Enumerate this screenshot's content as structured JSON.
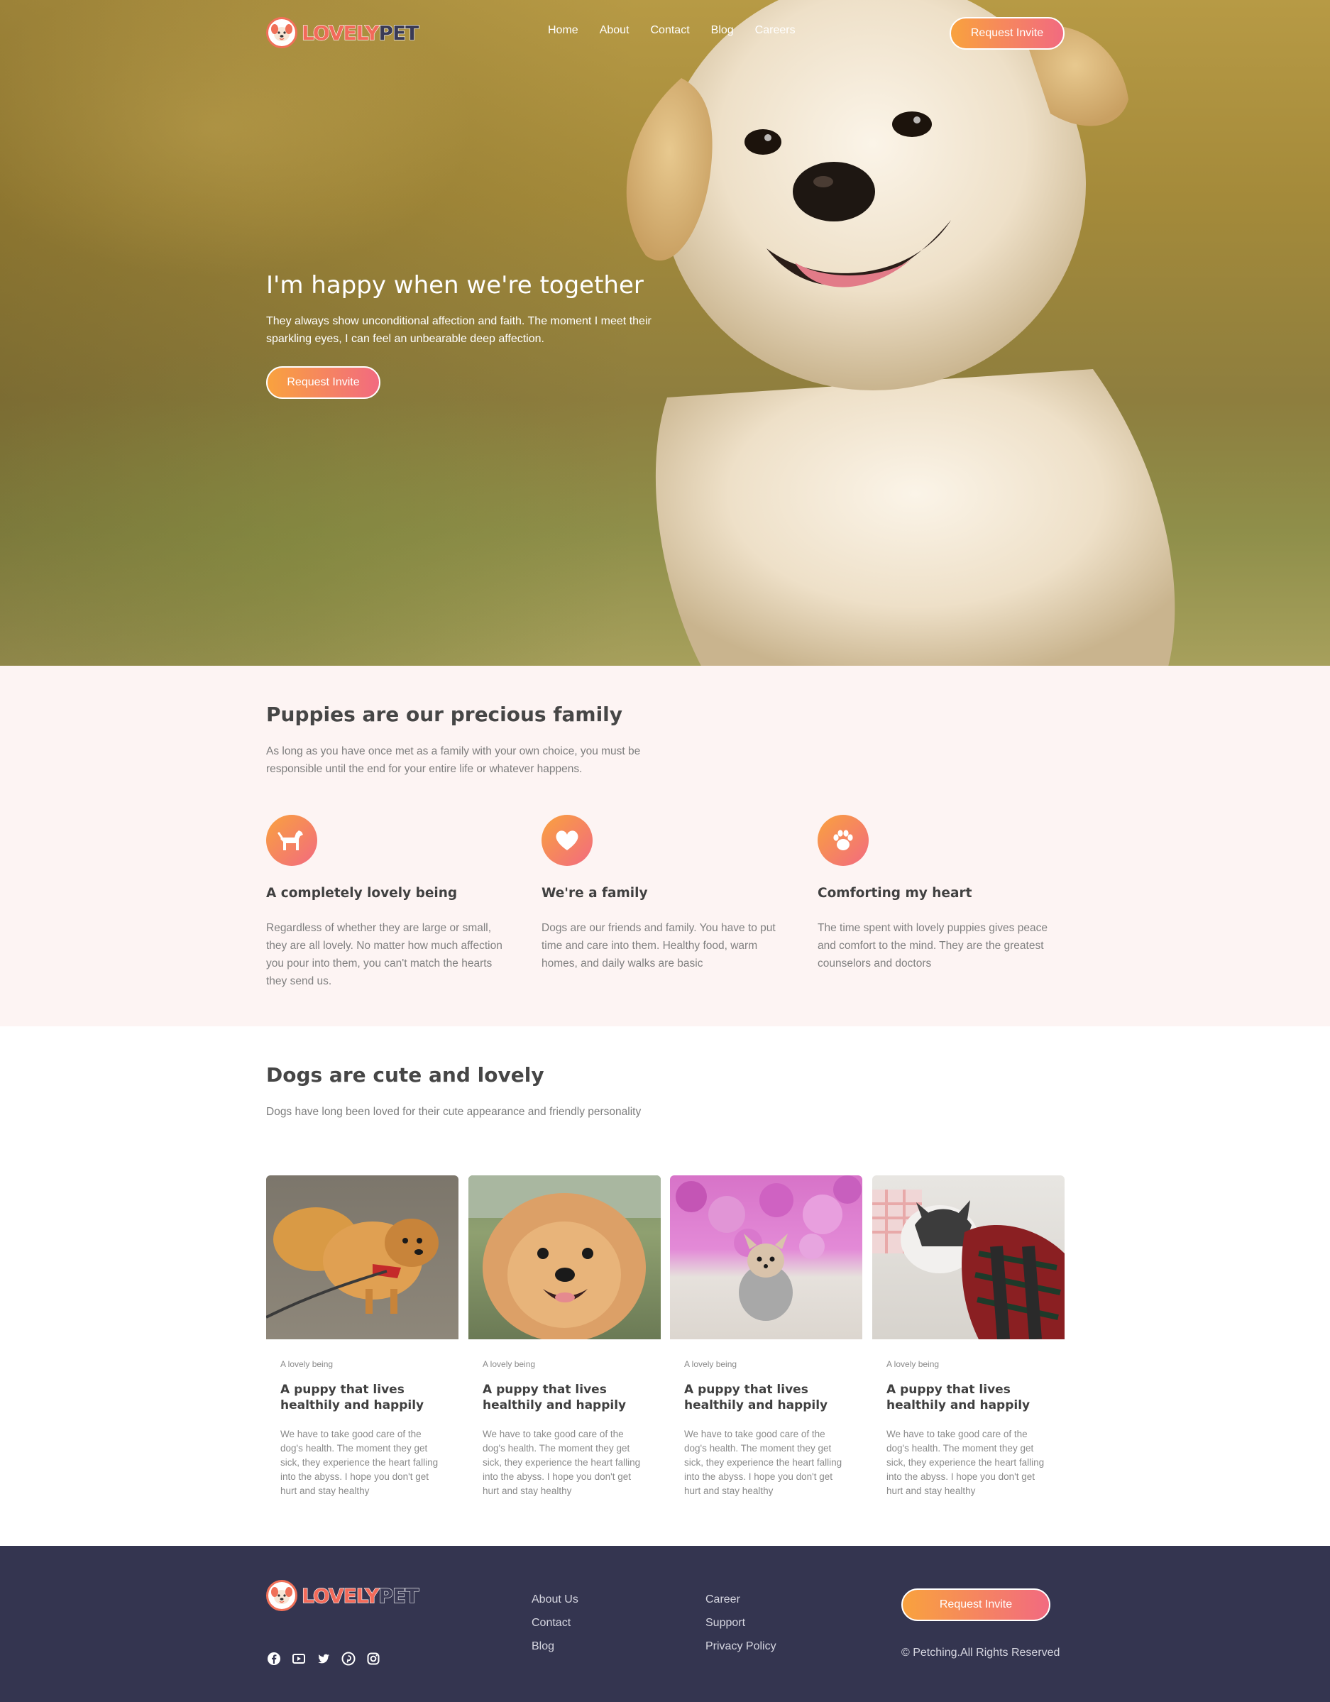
{
  "brand": {
    "part1": "LOVELY",
    "part2": "PET",
    "accent": "#f26a5a",
    "gradient_start": "#f9a23e",
    "gradient_end": "#f26a80"
  },
  "nav": {
    "links": [
      "Home",
      "About",
      "Contact",
      "Blog",
      "Careers"
    ],
    "cta": "Request Invite"
  },
  "hero": {
    "title": "I'm happy when we're together",
    "text": "They always show unconditional affection and faith. The moment I meet their sparkling eyes, I can feel an unbearable deep affection.",
    "cta": "Request Invite"
  },
  "family": {
    "title": "Puppies are our precious family",
    "subtitle": "As long as you have once met as a family with your own choice, you must be responsible until the end for your entire life or whatever happens.",
    "features": [
      {
        "icon": "dog-icon",
        "title": "A completely lovely being",
        "text": "Regardless of whether they are large or small, they are all lovely. No matter how much affection you pour into them, you can't match the hearts they send us."
      },
      {
        "icon": "heart-icon",
        "title": "We're a family",
        "text": "Dogs are our friends and family. You have to put time and care into them. Healthy food, warm homes, and daily walks are basic"
      },
      {
        "icon": "paw-icon",
        "title": "Comforting my heart",
        "text": "The time spent with lovely puppies gives peace and comfort to the mind. They are the greatest counselors and doctors"
      }
    ]
  },
  "dogs": {
    "title": "Dogs are cute and lovely",
    "subtitle": "Dogs have long been loved for their cute appearance and friendly personality",
    "cards": [
      {
        "photo": "pomeranian-on-leash-photo",
        "tag": "A lovely being",
        "title": "A puppy that lives healthily and happily",
        "text": "We have to take good care of the dog's health. The moment they get sick, they experience the heart falling into the abyss. I hope you don't get hurt and stay healthy"
      },
      {
        "photo": "smiling-pomeranian-photo",
        "tag": "A lovely being",
        "title": "A puppy that lives healthily and happily",
        "text": "We have to take good care of the dog's health. The moment they get sick, they experience the heart falling into the abyss. I hope you don't get hurt and stay healthy"
      },
      {
        "photo": "chihuahua-in-flowers-photo",
        "tag": "A lovely being",
        "title": "A puppy that lives healthily and happily",
        "text": "We have to take good care of the dog's health. The moment they get sick, they experience the heart falling into the abyss. I hope you don't get hurt and stay healthy"
      },
      {
        "photo": "sleeping-husky-photo",
        "tag": "A lovely being",
        "title": "A puppy that lives healthily and happily",
        "text": "We have to take good care of the dog's health. The moment they get sick, they experience the heart falling into the abyss. I hope you don't get hurt and stay healthy"
      }
    ]
  },
  "footer": {
    "col1": [
      "About Us",
      "Contact",
      "Blog"
    ],
    "col2": [
      "Career",
      "Support",
      "Privacy Policy"
    ],
    "cta": "Request Invite",
    "copyright": "© Petching.All Rights Reserved",
    "socials": [
      "facebook-icon",
      "youtube-icon",
      "twitter-icon",
      "pinterest-icon",
      "instagram-icon"
    ],
    "background": "#343550"
  }
}
